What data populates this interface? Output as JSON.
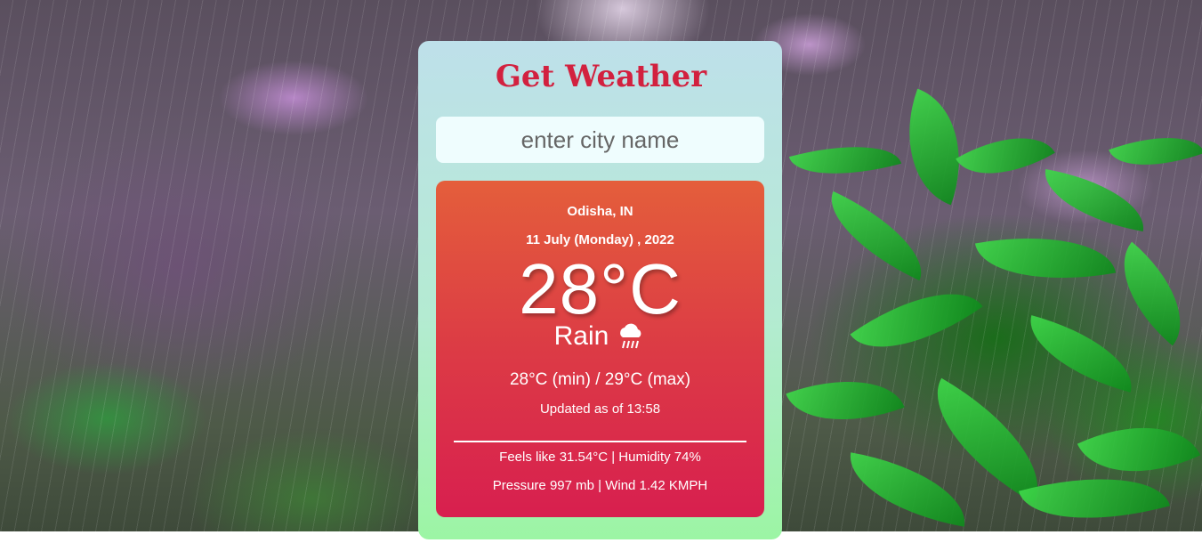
{
  "app": {
    "title": "Get Weather"
  },
  "search": {
    "placeholder": "enter city name",
    "value": ""
  },
  "weather": {
    "location": "Odisha, IN",
    "date": "11 July (Monday) , 2022",
    "temperature": "28°C",
    "condition": "Rain",
    "condition_icon": "rain-cloud-icon",
    "min_max": "28°C (min) / 29°C (max)",
    "updated": "Updated as of 13:58",
    "feels_humidity": "Feels like 31.54°C | Humidity 74%",
    "pressure_wind": "Pressure 997 mb | Wind 1.42 KMPH"
  },
  "colors": {
    "title": "#d2213f",
    "card_top": "#bee0ea",
    "card_bottom": "#9cf5a4",
    "result_top": "#e45e3b",
    "result_bottom": "#d81f4f",
    "search_bg": "#effdfe"
  },
  "background": {
    "description_icon": "rainy-garden-background"
  }
}
